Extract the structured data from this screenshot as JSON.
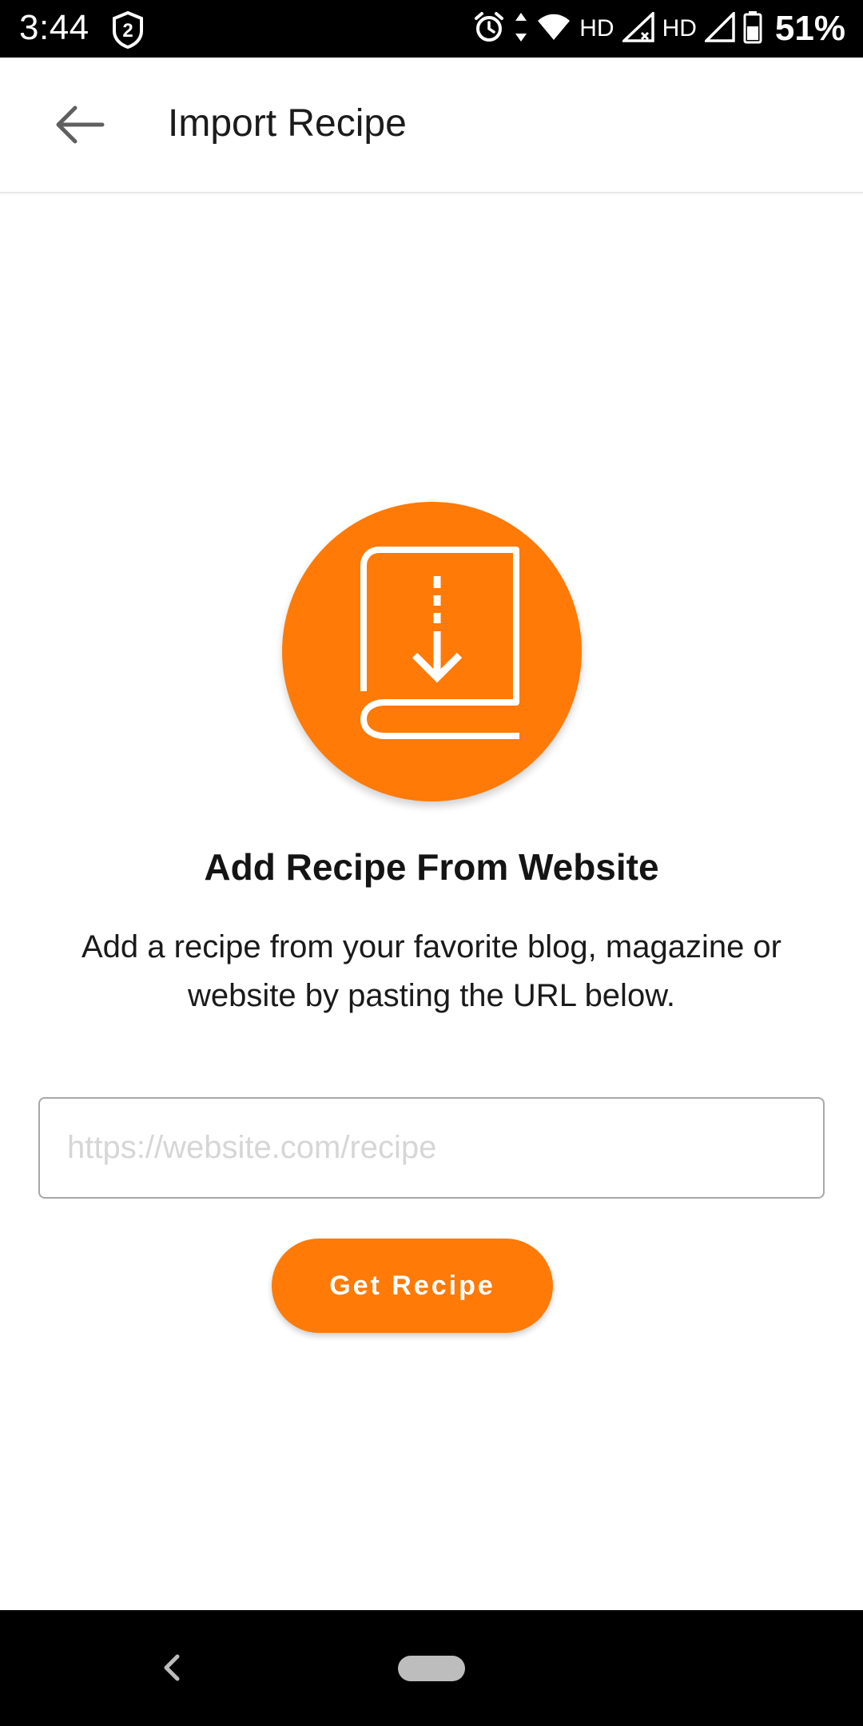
{
  "status_bar": {
    "time": "3:44",
    "notification_badge": "2",
    "network_label_1": "HD",
    "network_label_2": "HD",
    "battery_percent": "51%"
  },
  "app_bar": {
    "title": "Import Recipe",
    "back_icon": "arrow-left-icon"
  },
  "hero": {
    "icon": "book-download-icon",
    "color": "#ff7a07"
  },
  "import": {
    "title": "Add Recipe From Website",
    "description": "Add a recipe from your favorite blog, magazine or website by pasting the URL below.",
    "url_input": {
      "value": "",
      "placeholder": "https://website.com/recipe"
    },
    "button_label": "Get Recipe"
  },
  "colors": {
    "accent": "#ff7a07",
    "status_bar": "#000000",
    "nav_bar": "#000000"
  }
}
